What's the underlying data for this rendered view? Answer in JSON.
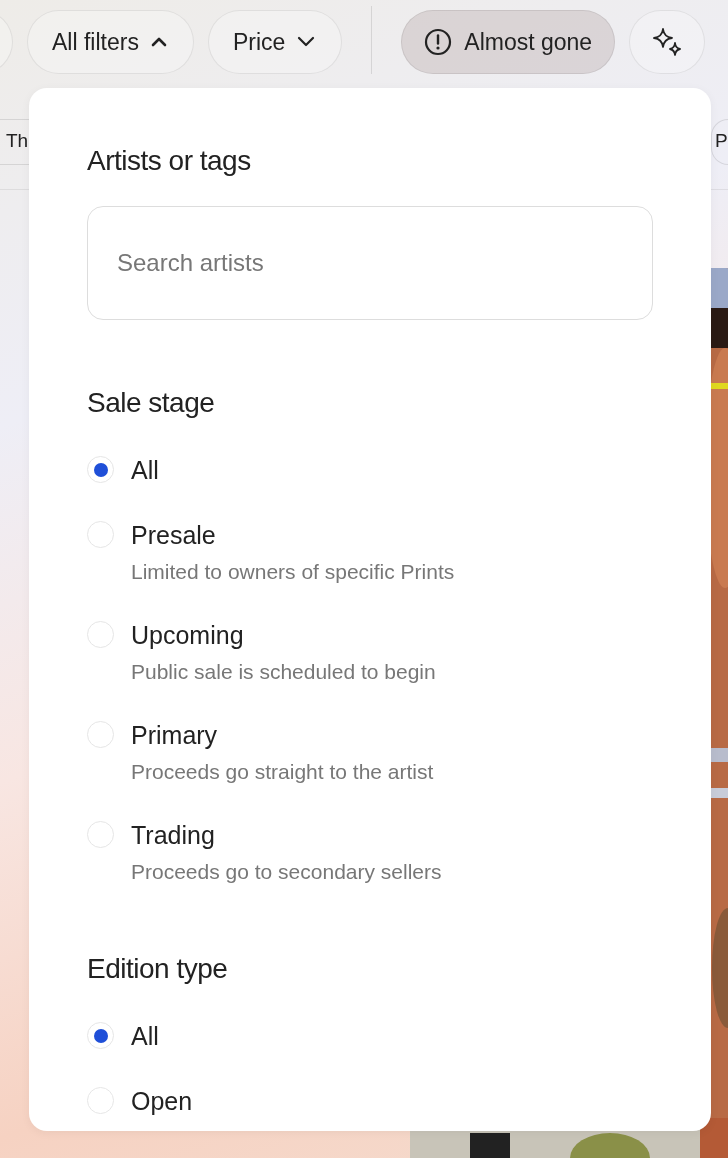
{
  "filter_bar": [
    {
      "kind": "blank"
    },
    {
      "kind": "dropdown",
      "label": "All filters",
      "expanded": true
    },
    {
      "kind": "dropdown",
      "label": "Price",
      "expanded": false
    },
    {
      "kind": "divider"
    },
    {
      "kind": "toggle",
      "label": "Almost gone",
      "selected": true
    },
    {
      "kind": "toggle",
      "selected": false
    }
  ],
  "tags": [
    {
      "label": "Th"
    },
    {
      "label": "P"
    }
  ],
  "filters_panel": {
    "sections": [
      {
        "kind": "search",
        "title": "Artists or tags",
        "placeholder": "Search artists"
      },
      {
        "kind": "radio",
        "title": "Sale stage",
        "options": [
          {
            "label": "All",
            "selected": true
          },
          {
            "label": "Presale",
            "description": "Limited to owners of specific Prints",
            "selected": false
          },
          {
            "label": "Upcoming",
            "description": "Public sale is scheduled to begin",
            "selected": false
          },
          {
            "label": "Primary",
            "description": "Proceeds go straight to the artist",
            "selected": false
          },
          {
            "label": "Trading",
            "description": "Proceeds go to secondary sellers",
            "selected": false
          }
        ]
      },
      {
        "kind": "radio",
        "title": "Edition type",
        "options": [
          {
            "label": "All",
            "selected": true
          },
          {
            "label": "Open",
            "selected": false
          }
        ]
      }
    ]
  }
}
